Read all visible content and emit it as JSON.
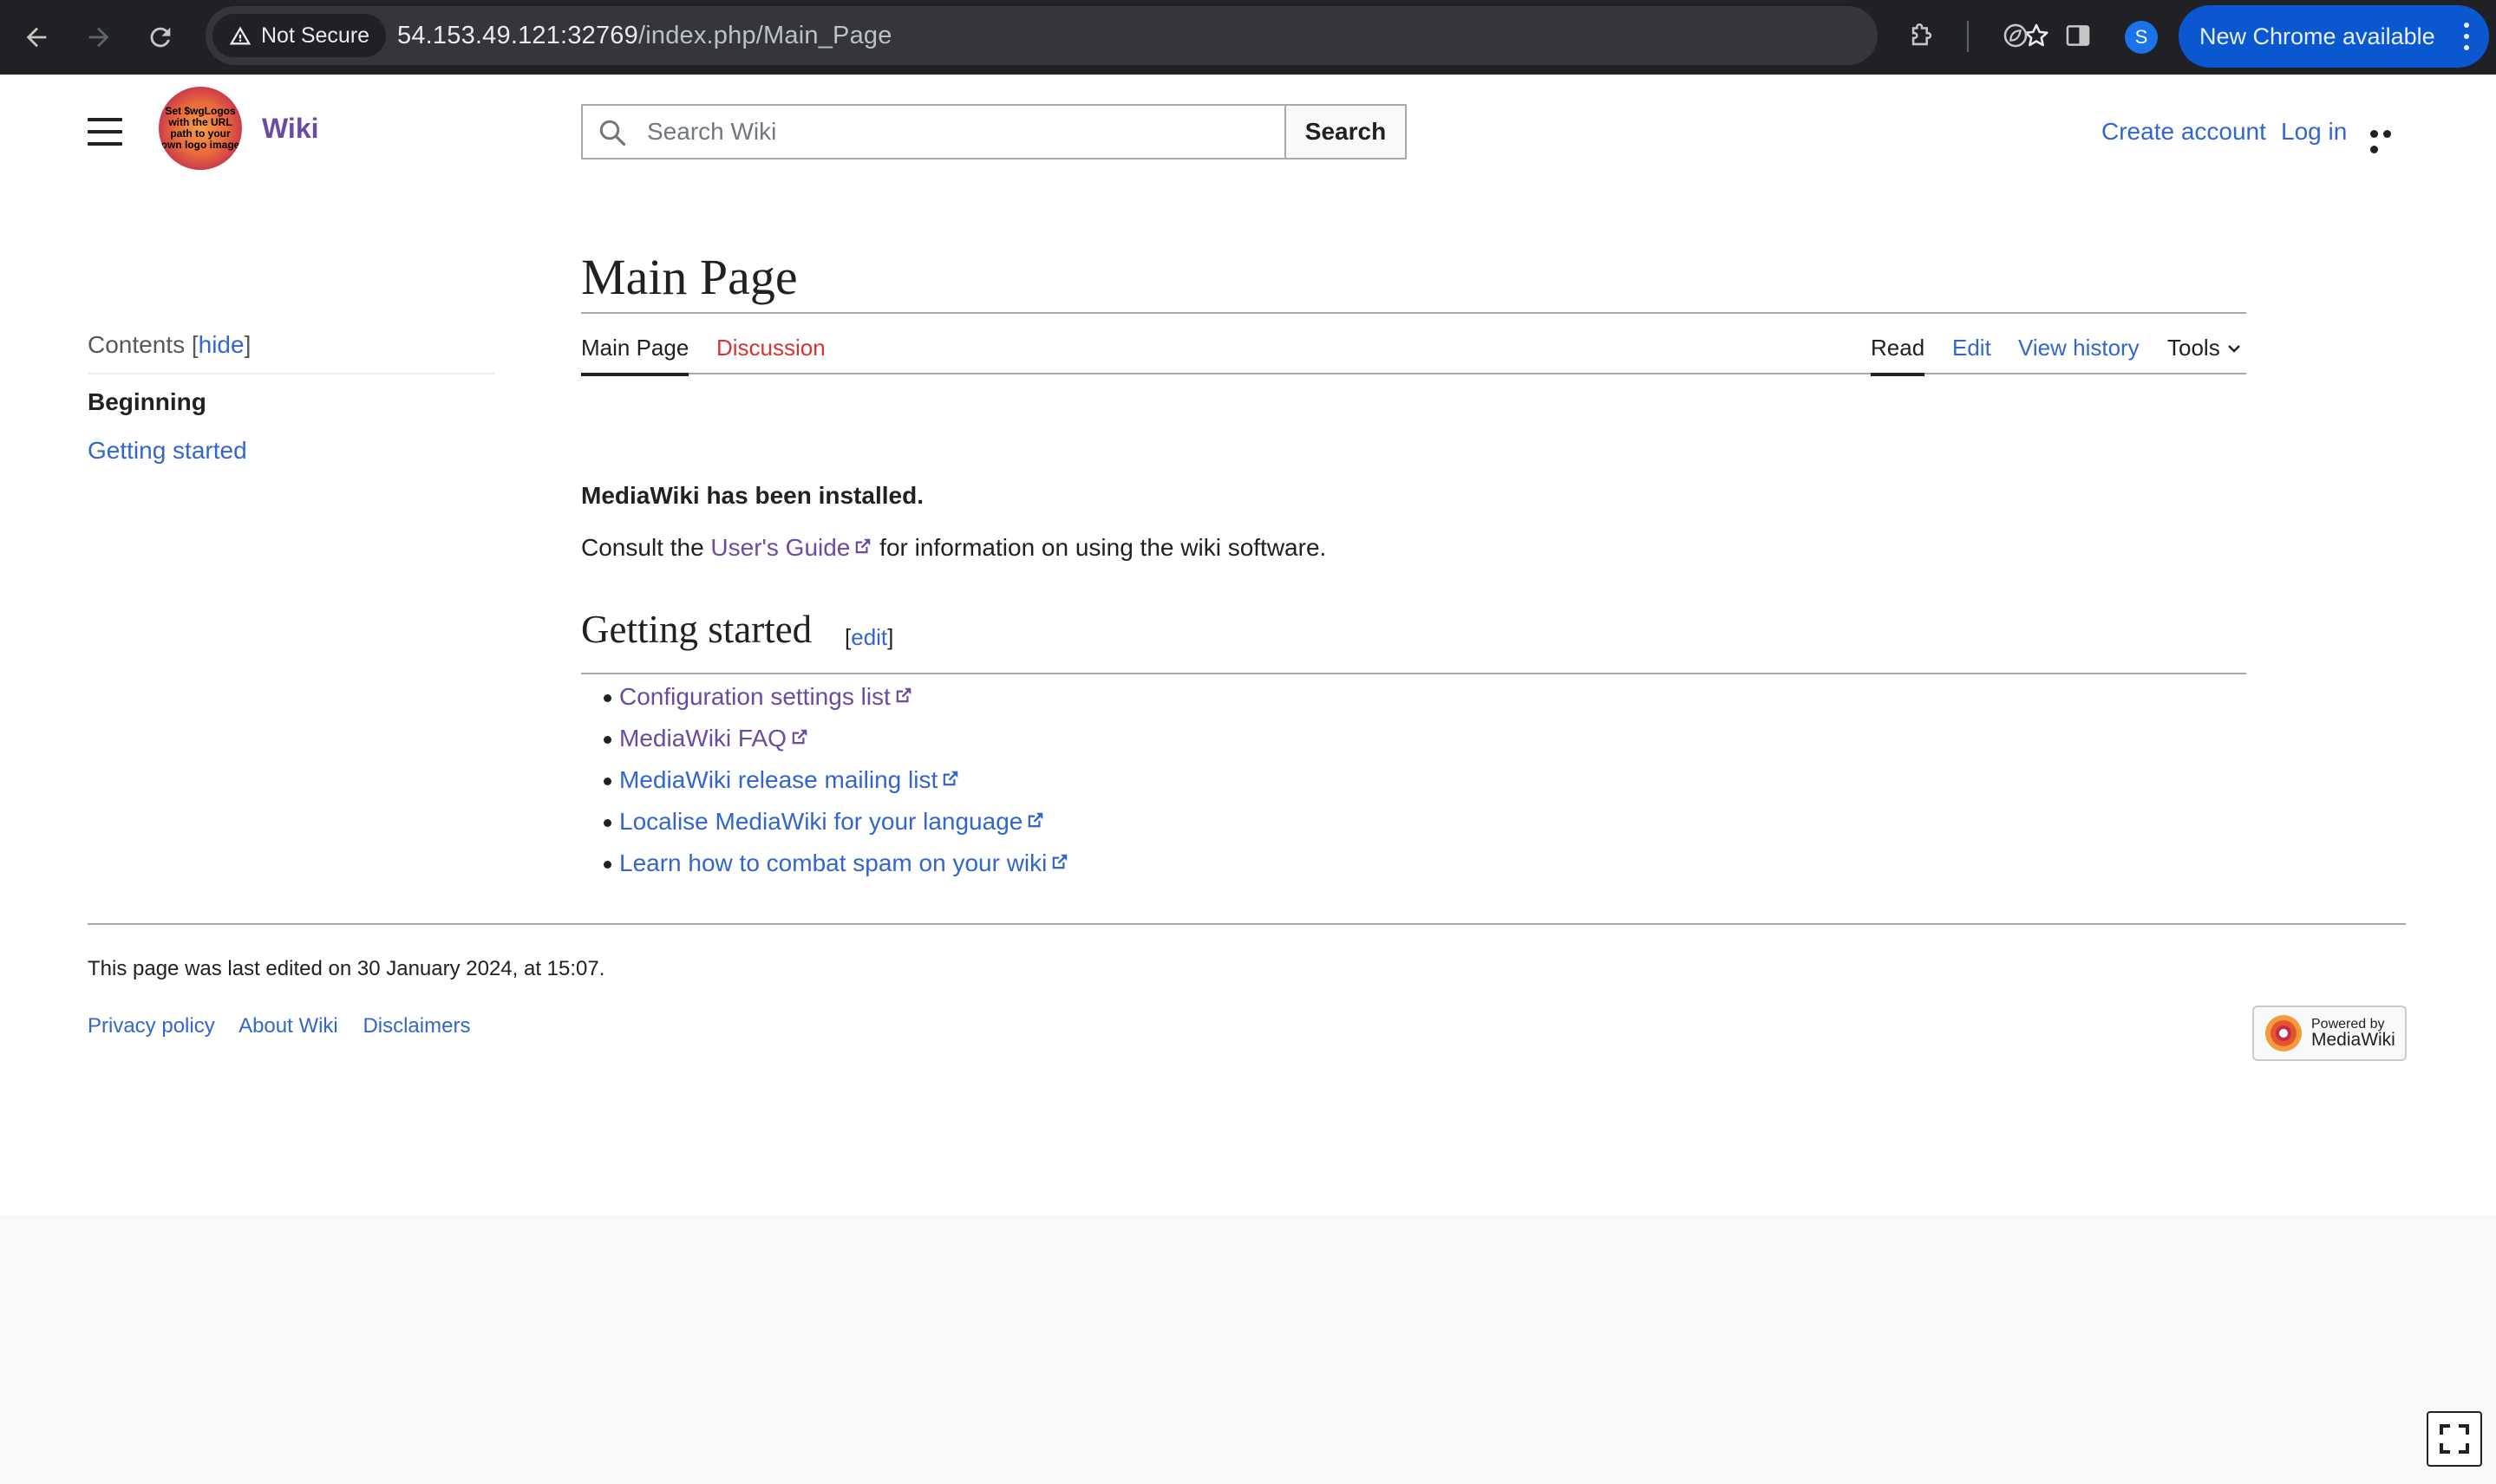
{
  "browser": {
    "security_label": "Not Secure",
    "url_host": "54.153.49.121:32769",
    "url_path": "/index.php/Main_Page",
    "profile_initial": "S",
    "update_label": "New Chrome available"
  },
  "header": {
    "logo_text": "Set $wgLogos with the URL path to your own logo image",
    "wordmark": "Wiki",
    "search_placeholder": "Search Wiki",
    "search_button": "Search",
    "create_account": "Create account",
    "log_in": "Log in"
  },
  "toc": {
    "title": "Contents",
    "hide_label": "hide",
    "beginning": "Beginning",
    "items": [
      "Getting started"
    ]
  },
  "content": {
    "page_title": "Main Page",
    "tabs_left": [
      "Main Page",
      "Discussion"
    ],
    "tabs_right": [
      "Read",
      "Edit",
      "View history",
      "Tools"
    ],
    "installed_text": "MediaWiki has been installed.",
    "consult_prefix": "Consult the",
    "consult_link": "User's Guide",
    "consult_suffix": "for information on using the wiki software.",
    "section_title": "Getting started",
    "section_edit": "edit",
    "links": [
      "Configuration settings list",
      "MediaWiki FAQ",
      "MediaWiki release mailing list",
      "Localise MediaWiki for your language",
      "Learn how to combat spam on your wiki"
    ]
  },
  "footer": {
    "last_edited": "This page was last edited on 30 January 2024, at 15:07.",
    "links": [
      "Privacy policy",
      "About Wiki",
      "Disclaimers"
    ],
    "powered_line1": "Powered by",
    "powered_line2": "MediaWiki"
  },
  "colors": {
    "link": "#3366cc",
    "visited_link": "#6b4ba1",
    "new_link": "#d73333",
    "chrome_bg": "#202124",
    "chrome_update": "#0b57d0"
  }
}
